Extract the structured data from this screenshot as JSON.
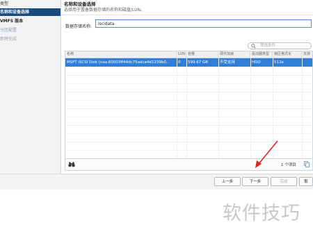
{
  "nav": {
    "items": [
      {
        "label": "类型",
        "state": "normal"
      },
      {
        "label": "名称和设备选择",
        "state": "active"
      },
      {
        "label": "VMFS 版本",
        "state": "bold"
      },
      {
        "label": "分区配置",
        "state": "muted"
      },
      {
        "label": "即将完成",
        "state": "muted"
      }
    ]
  },
  "header": {
    "title": "名称和设备选择",
    "subtitle": "选择用于置备数据存储的名称和磁盘/LUN。"
  },
  "form": {
    "datastore_label": "数据存储名称:",
    "datastore_value": "iscidata"
  },
  "filter": {
    "placeholder": "筛选条件",
    "icon": "search-icon"
  },
  "table": {
    "columns": [
      "名称",
      "LUN",
      "容量",
      "硬件加速",
      "驱动器类型",
      "扇区格式化",
      "支持"
    ],
    "rows": [
      {
        "name": "MSFT iSCSI Disk (naa.60003ff44dc75adca4d1239b0...",
        "lun": "0",
        "capacity": "599.67 GB",
        "hw_accel": "不受支持",
        "drive_type": "HDD",
        "sector_format": "512e",
        "support": ""
      }
    ],
    "footer_count": "1 个项目"
  },
  "buttons": {
    "back": "上一步",
    "next": "下一步",
    "finish": "完成",
    "cancel": "取"
  },
  "watermark": "软件技巧",
  "colors": {
    "accent": "#1b4b7c",
    "selection": "#2f7fd8",
    "arrow": "#e2231a"
  }
}
